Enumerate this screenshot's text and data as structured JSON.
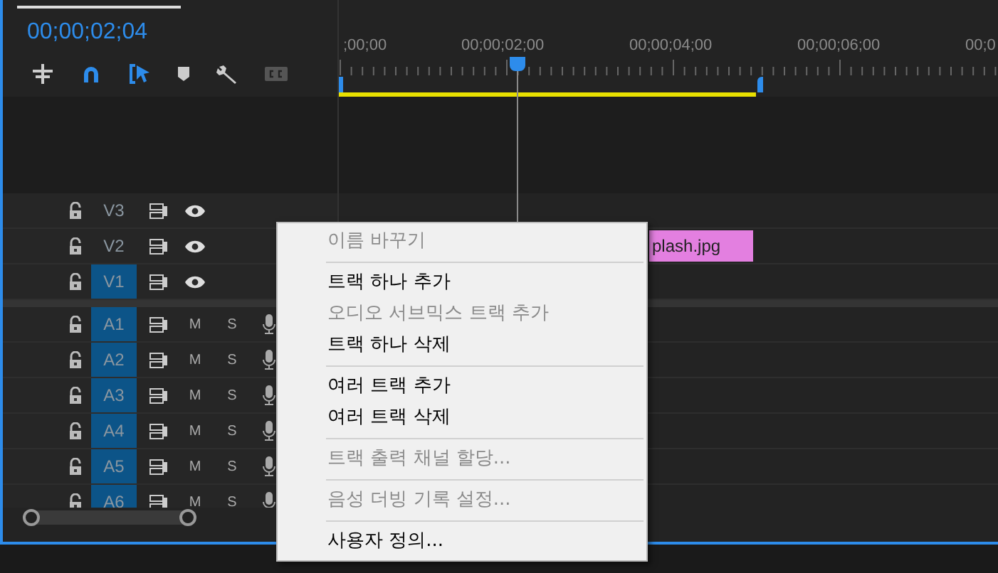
{
  "timecode": "00;00;02;04",
  "toolbar": {
    "snap_on": true,
    "linked_selection_on": true
  },
  "ruler": {
    "labels": [
      ";00;00",
      "00;00;02;00",
      "00;00;04;00",
      "00;00;06;00",
      "00;0"
    ]
  },
  "tracks": [
    {
      "name": "V3",
      "kind": "video",
      "targeted": false
    },
    {
      "name": "V2",
      "kind": "video",
      "targeted": false,
      "clip": "plash.jpg"
    },
    {
      "name": "V1",
      "kind": "video",
      "targeted": true
    },
    {
      "name": "A1",
      "kind": "audio",
      "targeted": true,
      "mute": "M",
      "solo": "S"
    },
    {
      "name": "A2",
      "kind": "audio",
      "targeted": true,
      "mute": "M",
      "solo": "S"
    },
    {
      "name": "A3",
      "kind": "audio",
      "targeted": true,
      "mute": "M",
      "solo": "S"
    },
    {
      "name": "A4",
      "kind": "audio",
      "targeted": true,
      "mute": "M",
      "solo": "S"
    },
    {
      "name": "A5",
      "kind": "audio",
      "targeted": true,
      "mute": "M",
      "solo": "S"
    },
    {
      "name": "A6",
      "kind": "audio",
      "targeted": true,
      "mute": "M",
      "solo": "S"
    }
  ],
  "context_menu": {
    "groups": [
      [
        {
          "label": "이름 바꾸기",
          "disabled": true
        }
      ],
      [
        {
          "label": "트랙 하나 추가",
          "disabled": false
        },
        {
          "label": "오디오 서브믹스 트랙 추가",
          "disabled": true
        },
        {
          "label": "트랙 하나 삭제",
          "disabled": false
        }
      ],
      [
        {
          "label": "여러 트랙 추가",
          "disabled": false
        },
        {
          "label": "여러 트랙 삭제",
          "disabled": false
        }
      ],
      [
        {
          "label": "트랙 출력 채널 할당...",
          "disabled": true
        }
      ],
      [
        {
          "label": "음성 더빙 기록 설정...",
          "disabled": true
        }
      ],
      [
        {
          "label": "사용자 정의...",
          "disabled": false
        }
      ]
    ]
  }
}
